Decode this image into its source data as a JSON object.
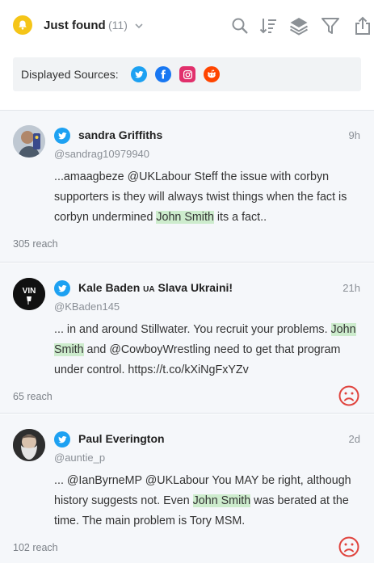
{
  "header": {
    "title": "Just found",
    "count": "(11)",
    "sources_label": "Displayed Sources:"
  },
  "colors": {
    "accent": "#f5c518",
    "twitter": "#1da1f2",
    "facebook": "#1877f2",
    "instagram": "#e1306c",
    "reddit": "#ff4500",
    "highlight": "#cdeccd",
    "negative": "#e0443e"
  },
  "icons": {
    "toolbar": [
      "search-icon",
      "sort-icon",
      "layers-icon",
      "filter-icon",
      "share-icon"
    ],
    "sources": [
      "twitter-icon",
      "facebook-icon",
      "instagram-icon",
      "reddit-icon"
    ]
  },
  "posts": [
    {
      "name": "sandra Griffiths",
      "handle": "@sandrag10979940",
      "time": "9h",
      "text_before": "...amaagbeze @UKLabour Steff the issue with corbyn supporters is they will always twist things when the fact is corbyn undermined ",
      "highlight": "John Smith",
      "text_after": " its a fact..",
      "reach": "305 reach",
      "sentiment": "neutral"
    },
    {
      "name": "Kale Baden 🇺🇦 Slava Ukraini!",
      "name_main": "Kale Baden",
      "name_flag": "UA",
      "name_rest": "Slava Ukraini!",
      "avatar_text": "VIN",
      "handle": "@KBaden145",
      "time": "21h",
      "text_before": "... in and around Stillwater. You recruit your problems. ",
      "highlight": "John Smith",
      "text_after": " and @CowboyWrestling need to get that program under control. https://t.co/kXiNgFxYZv",
      "reach": "65 reach",
      "sentiment": "negative"
    },
    {
      "name": "Paul Everington",
      "handle": "@auntie_p",
      "time": "2d",
      "text_before": "... @IanByrneMP @UKLabour You MAY be right, although history suggests not. Even ",
      "highlight": "John Smith",
      "text_after": " was berated at the time. The main problem is Tory MSM.",
      "reach": "102 reach",
      "sentiment": "negative"
    }
  ]
}
